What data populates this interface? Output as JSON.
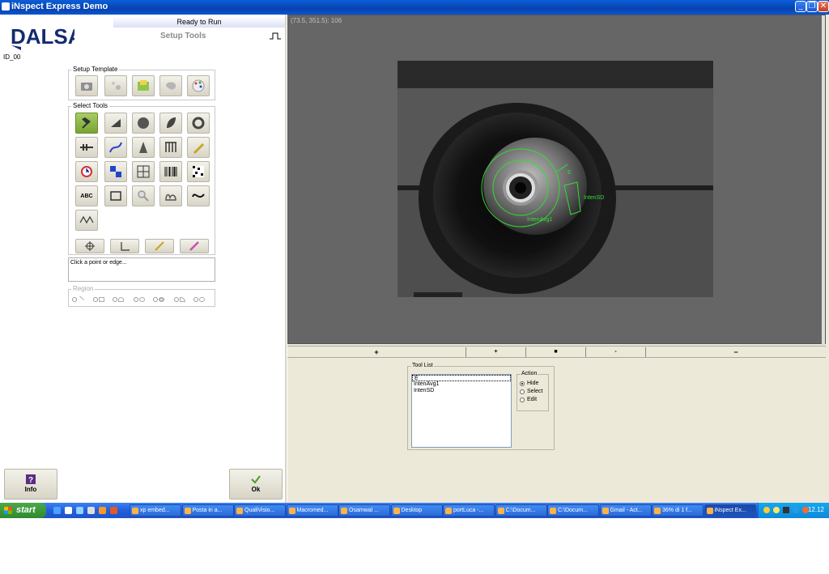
{
  "window": {
    "title": "iNspect Express Demo",
    "controls": [
      "_",
      "❐",
      "✕"
    ]
  },
  "left": {
    "logo_text": "DALSA",
    "status": "Ready to Run",
    "section_title": "Setup Tools",
    "device_id": "ID_00",
    "setup_template_label": "Setup Template",
    "select_tools_label": "Select Tools",
    "hint": "Click a point or edge...",
    "region_label": "Region",
    "info_label": "Info",
    "ok_label": "Ok",
    "tool_icons": [
      "hammer",
      "triangle",
      "circle",
      "leaf",
      "ring",
      "caliper",
      "curve",
      "tower",
      "comb",
      "pencil",
      "clock",
      "digits",
      "grid",
      "barcode",
      "datamatrix",
      "abc",
      "film",
      "magnifier",
      "hand",
      "wave",
      "sine"
    ],
    "template_icons": [
      "camera",
      "sparkle",
      "folder",
      "blob",
      "palette"
    ],
    "abc_text": "ABC"
  },
  "right": {
    "coord_readout": "(73.5, 351.5): 106",
    "zoom_buttons": [
      "+",
      "+",
      "■",
      "-",
      "−"
    ],
    "tool_list_label": "Tool List",
    "tools": [
      "E",
      "IntenAvg1",
      "IntenSD"
    ],
    "action_label": "Action",
    "actions": [
      {
        "label": "Hide",
        "selected": true
      },
      {
        "label": "Select",
        "selected": false
      },
      {
        "label": "Edit",
        "selected": false
      }
    ],
    "overlay_labels": {
      "e": "E",
      "intenavg": "IntenAvg1",
      "intensd": "IntenSD"
    },
    "overlay_color": "#33dd33"
  },
  "taskbar": {
    "start": "start",
    "tasks": [
      {
        "label": "xp embed...",
        "active": false
      },
      {
        "label": "Posta in a...",
        "active": false
      },
      {
        "label": "QualiVisio...",
        "active": false
      },
      {
        "label": "Macromed...",
        "active": false
      },
      {
        "label": "Osamwal ...",
        "active": false
      },
      {
        "label": "Desktop",
        "active": false
      },
      {
        "label": "portLuca -...",
        "active": false
      },
      {
        "label": "C:\\Docum...",
        "active": false
      },
      {
        "label": "C:\\Docum...",
        "active": false
      },
      {
        "label": "Gmail - Act...",
        "active": false
      },
      {
        "label": "36% di 1 f...",
        "active": false
      },
      {
        "label": "iNspect Ex...",
        "active": true
      }
    ],
    "clock": "12.12"
  }
}
